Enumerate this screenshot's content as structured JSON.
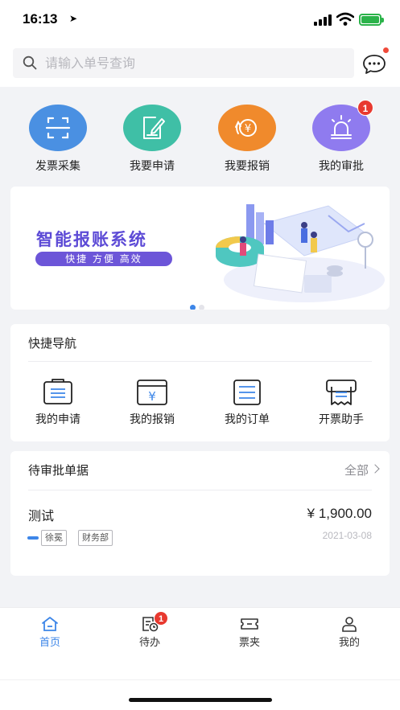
{
  "status_bar": {
    "time": "16:13"
  },
  "search": {
    "placeholder": "请输入单号查询"
  },
  "quick_actions": [
    {
      "label": "发票采集",
      "icon": "scan-icon",
      "color": "#4a90e2"
    },
    {
      "label": "我要申请",
      "icon": "edit-icon",
      "color": "#3fbfa6"
    },
    {
      "label": "我要报销",
      "icon": "reimburse-icon",
      "color": "#f08a2c"
    },
    {
      "label": "我的审批",
      "icon": "alarm-icon",
      "color": "#8f7bef",
      "badge": "1"
    }
  ],
  "banner": {
    "title": "智能报账系统",
    "subtitle": "快捷  方便  高效",
    "page_indicator": {
      "current": 1,
      "total": 2
    }
  },
  "quick_nav": {
    "title": "快捷导航",
    "items": [
      {
        "label": "我的申请",
        "icon": "application-icon"
      },
      {
        "label": "我的报销",
        "icon": "yuan-card-icon"
      },
      {
        "label": "我的订单",
        "icon": "order-list-icon"
      },
      {
        "label": "开票助手",
        "icon": "printer-icon"
      }
    ]
  },
  "pending": {
    "title": "待审批单据",
    "more_label": "全部",
    "items": [
      {
        "name": "测试",
        "amount": "¥ 1,900.00",
        "date": "2021-03-08",
        "tags": [
          "徐冕",
          "财务部"
        ]
      }
    ]
  },
  "tab_bar": {
    "tabs": [
      {
        "label": "首页",
        "icon": "home-icon",
        "active": true
      },
      {
        "label": "待办",
        "icon": "todo-icon",
        "badge": "1"
      },
      {
        "label": "票夹",
        "icon": "ticket-icon"
      },
      {
        "label": "我的",
        "icon": "user-icon"
      }
    ]
  },
  "colors": {
    "accent": "#3d86e8",
    "banner_purple": "#5d4bd6",
    "badge_red": "#e8392f"
  }
}
